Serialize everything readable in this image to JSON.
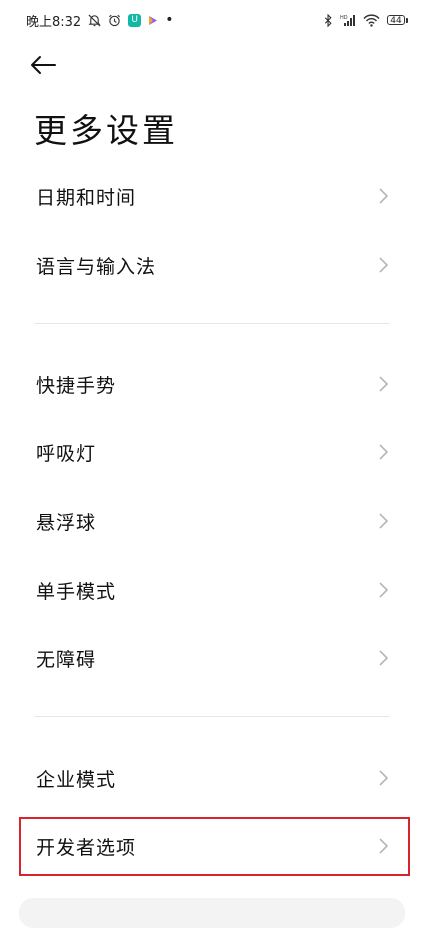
{
  "status_bar": {
    "time": "晚上8:32",
    "app_badge_letter": "U",
    "battery": "44",
    "icons": [
      "mute-bell-icon",
      "alarm-icon",
      "app-icon",
      "play-icon",
      "bluetooth-icon",
      "hd-signal-icon",
      "wifi-icon",
      "battery-icon"
    ]
  },
  "header": {
    "back_icon": "arrow-left-icon",
    "title": "更多设置"
  },
  "items": [
    {
      "label": "日期和时间"
    },
    {
      "label": "语言与输入法"
    },
    {
      "label": "快捷手势"
    },
    {
      "label": "呼吸灯"
    },
    {
      "label": "悬浮球"
    },
    {
      "label": "单手模式"
    },
    {
      "label": "无障碍"
    },
    {
      "label": "企业模式"
    },
    {
      "label": "开发者选项"
    }
  ],
  "colors": {
    "highlight": "#d9232d",
    "chevron": "#b5b5b5",
    "divider": "#e6e6e6"
  }
}
